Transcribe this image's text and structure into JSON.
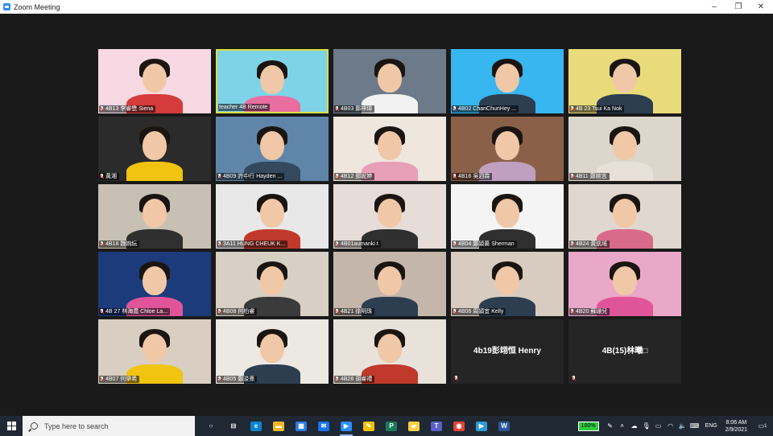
{
  "window": {
    "title": "Zoom Meeting"
  },
  "window_controls": {
    "minimize": "–",
    "maximize": "❐",
    "close": "✕"
  },
  "participants": [
    {
      "name": "4B13 李睿懋 Siena",
      "muted": true,
      "bg": "#f7d9e3",
      "shirt": "#d63b3b"
    },
    {
      "name": "teacher 4B Remote",
      "muted": false,
      "active": true,
      "bg": "#7fd3e8",
      "shirt": "#e96ea0"
    },
    {
      "name": "4B03 鄭梓瑋",
      "muted": true,
      "bg": "#6c7a89",
      "shirt": "#f2f2f2"
    },
    {
      "name": "4B02 ChanChunHey ...",
      "muted": true,
      "bg": "#38b6f0",
      "shirt": "#2c3e50"
    },
    {
      "name": "4B 23 Tsui Ka Nok",
      "muted": true,
      "bg": "#e8dc7a",
      "shirt": "#2c3e50"
    },
    {
      "name": "黃湘",
      "muted": true,
      "bg": "#2b2b2b",
      "shirt": "#f1c40f"
    },
    {
      "name": "4B09 許中行 Hayden ...",
      "muted": true,
      "bg": "#5f86a8",
      "shirt": "#34495e"
    },
    {
      "name": "4B12 鄧妮婷",
      "muted": true,
      "bg": "#efe6de",
      "shirt": "#e8a0b8"
    },
    {
      "name": "4B16 吳泗霖",
      "muted": true,
      "bg": "#8a6048",
      "shirt": "#bfa0c0"
    },
    {
      "name": "4B11 鄭婉言",
      "muted": true,
      "bg": "#dcd6cc",
      "shirt": "#e8e0d8"
    },
    {
      "name": "4B18 魏婉紜",
      "muted": true,
      "bg": "#c8c0b4",
      "shirt": "#2f2f2f"
    },
    {
      "name": "3A11 HUNG CHEUK K...",
      "muted": true,
      "bg": "#e8e8e8",
      "shirt": "#c0392b"
    },
    {
      "name": "4B01aumanki t",
      "muted": true,
      "bg": "#e6ddd8",
      "shirt": "#2f2f2f"
    },
    {
      "name": "4B04 鄭潁蕎 Sherman",
      "muted": true,
      "bg": "#f4f4f4",
      "shirt": "#2f2f2f"
    },
    {
      "name": "4B24 黃凱瑤",
      "muted": true,
      "bg": "#e0d8d0",
      "shirt": "#d86a8a"
    },
    {
      "name": "4B 27 林海喬 Chloe La...",
      "muted": true,
      "bg": "#1c3b7a",
      "shirt": "#e0559a"
    },
    {
      "name": "4B08 何柏睿",
      "muted": true,
      "bg": "#d8d0c4",
      "shirt": "#3b3b3b"
    },
    {
      "name": "4B21 徐明珠",
      "muted": true,
      "bg": "#c4b6aa",
      "shirt": "#2c3e50"
    },
    {
      "name": "4B06 周潁宜 Kelly",
      "muted": true,
      "bg": "#d8ccc0",
      "shirt": "#2c3e50"
    },
    {
      "name": "4B20 蘇珊兒",
      "muted": true,
      "bg": "#e9a8c8",
      "shirt": "#e0559a"
    },
    {
      "name": "4B07 何樂希",
      "muted": true,
      "bg": "#d8cfc2",
      "shirt": "#f1c40f"
    },
    {
      "name": "4B05 鄭浚熹",
      "muted": true,
      "bg": "#ece8e2",
      "shirt": "#2c3e50"
    },
    {
      "name": "4B26 胡睿禮",
      "muted": true,
      "bg": "#e8e2da",
      "shirt": "#c0392b"
    },
    {
      "name": "4b19彭翊恒 Henry",
      "muted": true,
      "video_off": true
    },
    {
      "name": "4B(15)林曦□",
      "muted": true,
      "video_off": true
    }
  ],
  "taskbar": {
    "search_placeholder": "Type here to search",
    "apps": [
      {
        "name": "task-view",
        "glyph": "○",
        "color": "transparent"
      },
      {
        "name": "widgets",
        "glyph": "⊟",
        "color": "transparent"
      },
      {
        "name": "edge",
        "glyph": "e",
        "color": "#0a84d0"
      },
      {
        "name": "file-explorer",
        "glyph": "▬",
        "color": "#f2b824"
      },
      {
        "name": "store",
        "glyph": "▦",
        "color": "#2a7de1"
      },
      {
        "name": "mail",
        "glyph": "✉",
        "color": "#1a73e8"
      },
      {
        "name": "zoom",
        "glyph": "▶",
        "color": "#2d8cff",
        "running": true
      },
      {
        "name": "whiteboard",
        "glyph": "✎",
        "color": "#f2c200"
      },
      {
        "name": "publisher",
        "glyph": "P",
        "color": "#1b7a5a"
      },
      {
        "name": "sticky-notes",
        "glyph": "▰",
        "color": "#f7d046"
      },
      {
        "name": "teams",
        "glyph": "T",
        "color": "#5b5fc7"
      },
      {
        "name": "chrome",
        "glyph": "◉",
        "color": "#e0453a"
      },
      {
        "name": "media",
        "glyph": "▶",
        "color": "#2a9bd8"
      },
      {
        "name": "word",
        "glyph": "W",
        "color": "#2b579a"
      }
    ],
    "battery": "100%",
    "language": "ENG",
    "time": "8:06 AM",
    "date": "2/9/2021",
    "notifications": "1"
  }
}
